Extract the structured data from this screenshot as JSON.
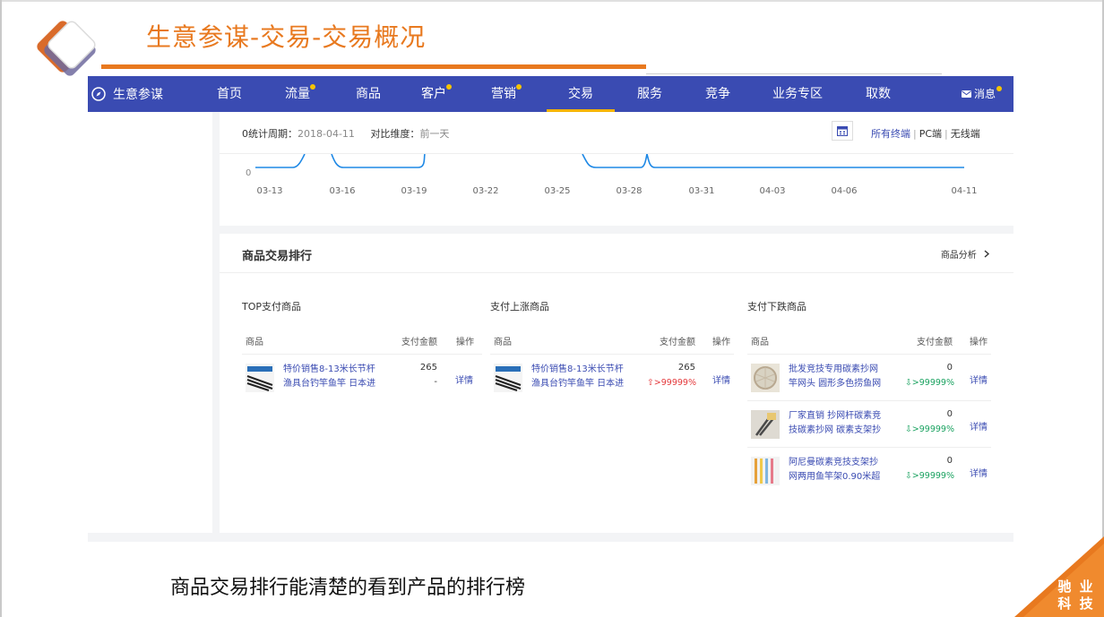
{
  "slide": {
    "title": "生意参谋-交易-交易概况",
    "caption": "商品交易排行能清楚的看到产品的排行榜",
    "corner_line1": "驰 业",
    "corner_line2": "科 技",
    "accent_color": "#e8791f"
  },
  "nav": {
    "brand": "生意参谋",
    "items": [
      {
        "label": "首页",
        "dot": false
      },
      {
        "label": "流量",
        "dot": true
      },
      {
        "label": "商品",
        "dot": false
      },
      {
        "label": "客户",
        "dot": true
      },
      {
        "label": "营销",
        "dot": true
      },
      {
        "label": "交易",
        "dot": false,
        "active": true
      },
      {
        "label": "服务",
        "dot": false
      },
      {
        "label": "竞争",
        "dot": false
      },
      {
        "label": "业务专区",
        "dot": false
      },
      {
        "label": "取数",
        "dot": false
      }
    ],
    "message": "消息",
    "bg_color": "#3a4bb2"
  },
  "filter": {
    "period_label": "0统计周期：",
    "period_value": "2018-04-11",
    "compare_label": "对比维度：",
    "compare_value": "前一天",
    "device_all": "所有终端",
    "device_pc": "PC端",
    "device_wireless": "无线端"
  },
  "chart_data": {
    "type": "line",
    "y_tick_labels": [
      "0"
    ],
    "x_tick_labels": [
      "03-13",
      "03-16",
      "03-19",
      "03-22",
      "03-25",
      "03-28",
      "03-31",
      "04-03",
      "04-06",
      "04-11"
    ],
    "series_color": "#1e88e5"
  },
  "ranking": {
    "title": "商品交易排行",
    "analysis_link": "商品分析",
    "columns": [
      {
        "title": "TOP支付商品",
        "headers": [
          "商品",
          "支付金额",
          "操作"
        ],
        "rows": [
          {
            "name_line1": "特价销售8-13米长节杆",
            "name_line2": "渔具台钓竿鱼竿 日本进",
            "amount": "265",
            "change": "-",
            "action": "详情"
          }
        ]
      },
      {
        "title": "支付上涨商品",
        "headers": [
          "商品",
          "支付金额",
          "操作"
        ],
        "rows": [
          {
            "name_line1": "特价销售8-13米长节杆",
            "name_line2": "渔具台钓竿鱼竿 日本进",
            "amount": "265",
            "change": ">99999%",
            "action": "详情"
          }
        ]
      },
      {
        "title": "支付下跌商品",
        "headers": [
          "商品",
          "支付金额",
          "操作"
        ],
        "rows": [
          {
            "name_line1": "批发竞技专用碳素抄网",
            "name_line2": "竿网头 圆形多色捞鱼网",
            "amount": "0",
            "change": ">99999%",
            "action": "详情"
          },
          {
            "name_line1": "厂家直销 抄网杆碳素竞",
            "name_line2": "技碳素抄网 碳素支架抄",
            "amount": "0",
            "change": ">99999%",
            "action": "详情"
          },
          {
            "name_line1": "阿尼曼碳素竞技支架抄",
            "name_line2": "网两用鱼竿架0.90米超",
            "amount": "0",
            "change": ">99999%",
            "action": "详情"
          }
        ]
      }
    ]
  }
}
